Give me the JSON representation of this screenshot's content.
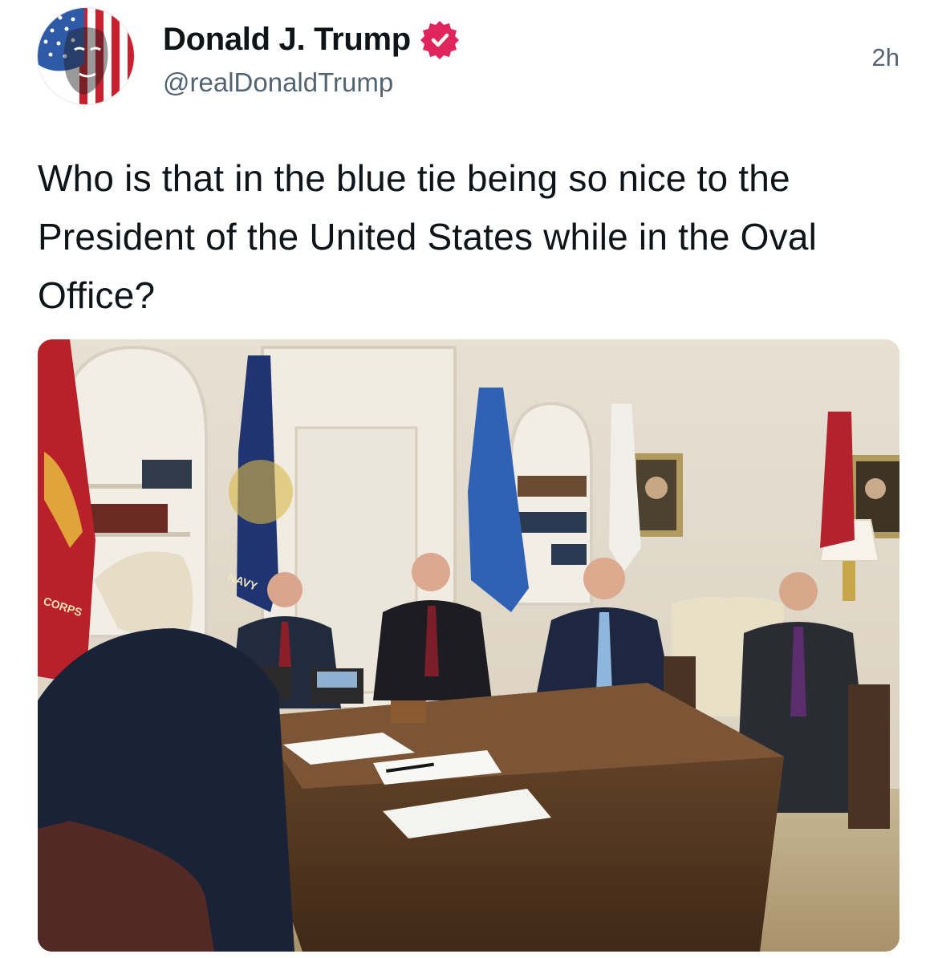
{
  "post": {
    "author": {
      "display_name": "Donald J. Trump",
      "handle": "@realDonaldTrump",
      "verified_icon": "verified-badge-icon",
      "avatar_icon": "flag-portrait-avatar"
    },
    "timestamp": "2h",
    "text": "Who is that in the blue tie being so nice to the President of the United States while in the Oval Office?",
    "media": {
      "kind": "photo",
      "embedded_text": [
        "NAVY",
        "CORPS"
      ]
    }
  },
  "colors": {
    "verified_badge": "#e0245e",
    "handle_gray": "#536471",
    "text_dark": "#0f1419"
  }
}
